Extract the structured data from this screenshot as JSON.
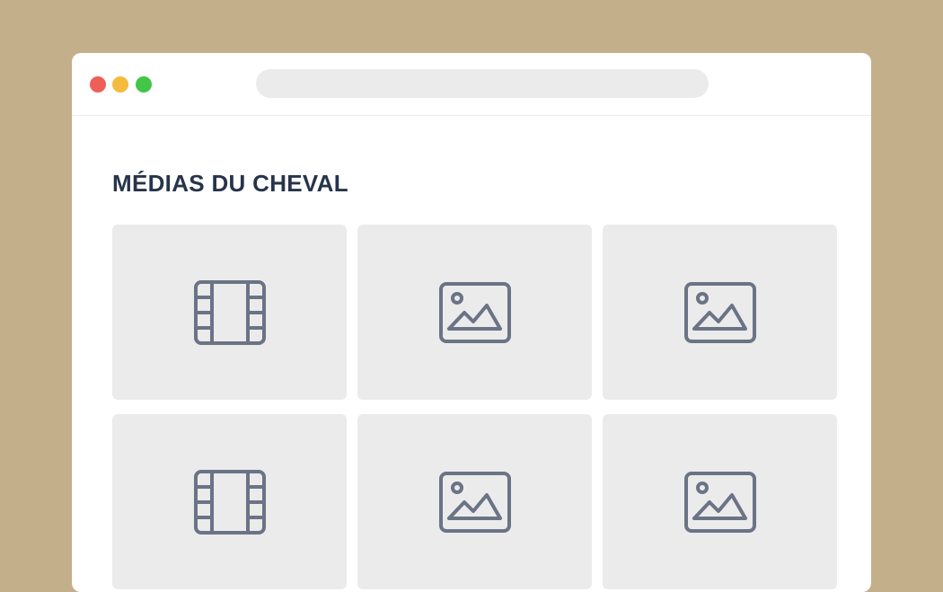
{
  "window": {
    "controls": [
      "close",
      "minimize",
      "maximize"
    ],
    "address_bar": {
      "value": "",
      "placeholder": ""
    }
  },
  "page": {
    "title": "MÉDIAS DU CHEVAL"
  },
  "media_grid": {
    "items": [
      {
        "type": "video",
        "icon": "film-icon"
      },
      {
        "type": "image",
        "icon": "image-icon"
      },
      {
        "type": "image",
        "icon": "image-icon"
      },
      {
        "type": "video",
        "icon": "film-icon"
      },
      {
        "type": "image",
        "icon": "image-icon"
      },
      {
        "type": "image",
        "icon": "image-icon"
      }
    ]
  },
  "colors": {
    "background": "#c3b08b",
    "window": "#ffffff",
    "tile": "#ebebeb",
    "icon_stroke": "#6b7386",
    "title_text": "#27344a",
    "close": "#ee5f57",
    "minimize": "#f5bb3e",
    "maximize": "#43c547"
  }
}
